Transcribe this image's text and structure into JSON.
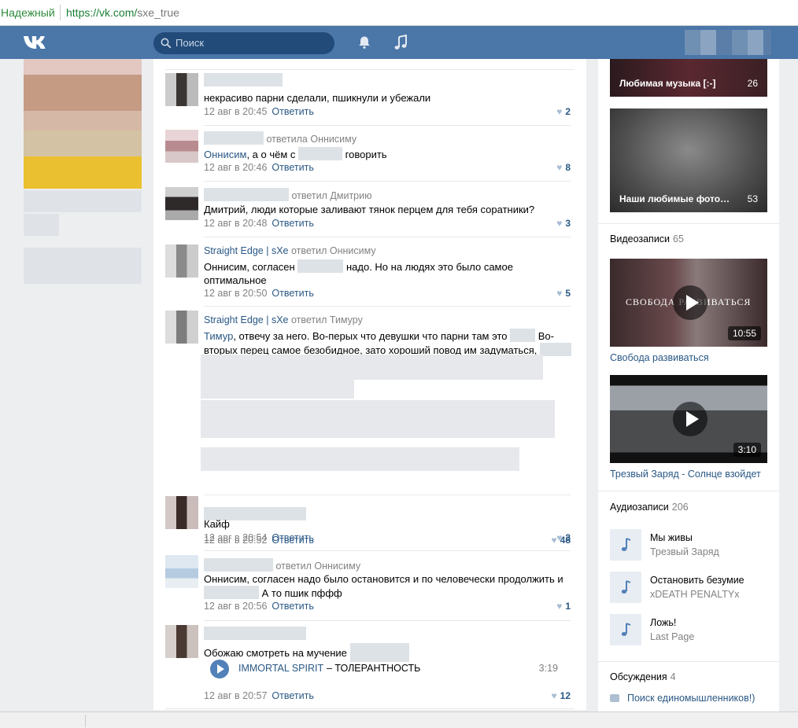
{
  "browser": {
    "secure_label": "Надежный",
    "url_host": "https://vk.com/",
    "url_path": "sxe_true"
  },
  "header": {
    "search_placeholder": "Поиск"
  },
  "comments": [
    {
      "author": "",
      "reply_to": "",
      "text": "некрасиво парни сделали, пшикнули и убежали",
      "time": "12 авг в 20:45",
      "answer": "Ответить",
      "likes": "2"
    },
    {
      "author": "",
      "reply_to": "ответила Оннисиму",
      "text_link": "Оннисим",
      "text_a": ", а о чём с",
      "text_b": "говорить",
      "time": "12 авг в 20:46",
      "answer": "Ответить",
      "likes": "8"
    },
    {
      "author": "",
      "reply_to": "ответил Дмитрию",
      "text": "Дмитрий, люди которые заливают тянок перцем для тебя соратники?",
      "time": "12 авг в 20:48",
      "answer": "Ответить",
      "likes": "3"
    },
    {
      "author": "Straight Edge | sXe",
      "reply_to": "ответил Оннисиму",
      "text_a": "Оннисим, согласен",
      "text_b": "надо. Но на людях это было самое оптимальное",
      "time": "12 авг в 20:50",
      "answer": "Ответить",
      "likes": "5"
    },
    {
      "author": "Straight Edge | sXe",
      "reply_to": "ответил Тимуру",
      "text_link": "Тимур",
      "text_a": ", отвечу за него. Во-перых что девушки что парни там это",
      "text_b": "Во-вторых перец самое безобидное, зато хороший повод им задуматься,",
      "time": "12 авг в 20:52",
      "answer": "Ответить",
      "likes": "48"
    },
    {
      "author": "",
      "reply_to": "",
      "text": "Кайф",
      "time": "12 авг в 20:54",
      "answer": "Ответить",
      "likes": "3"
    },
    {
      "author": "",
      "reply_to": "ответил Оннисиму",
      "text_a": "Оннисим, согласен надо было остановится и по человечески продолжить и",
      "text_b": "А то пшик пффф",
      "time": "12 авг в 20:56",
      "answer": "Ответить",
      "likes": "1"
    },
    {
      "author": "",
      "reply_to": "",
      "text": "Обожаю смотреть на мучение",
      "time": "12 авг в 20:57",
      "answer": "Ответить",
      "likes": "12"
    }
  ],
  "attached_audio": {
    "artist": "IMMORTAL SPIRIT",
    "title": "– ТОЛЕРАНТНОСТЬ",
    "duration": "3:19"
  },
  "sidebar": {
    "album1": {
      "label": "Любимая музыка [:-]",
      "count": "26"
    },
    "album2": {
      "label": "Наши любимые фото…",
      "count": "53"
    },
    "videos": {
      "title": "Видеозаписи",
      "count": "65"
    },
    "video1": {
      "title": "Свобода развиваться",
      "duration": "10:55",
      "overlay": "СВОБОДА РАЗВИВАТЬСЯ"
    },
    "video2": {
      "title": "Трезвый Заряд - Солнце взойдет",
      "duration": "3:10"
    },
    "audios": {
      "title": "Аудиозаписи",
      "count": "206"
    },
    "tracks": [
      {
        "name": "Мы живы",
        "artist": "Трезвый Заряд"
      },
      {
        "name": "Остановить безумие",
        "artist": "xDEATH PENALTYx"
      },
      {
        "name": "Ложь!",
        "artist": "Last Page"
      }
    ],
    "discussions": {
      "title": "Обсуждения",
      "count": "4",
      "item": "Поиск единомышленников!)"
    }
  },
  "colors": {
    "header": "#4a76a8",
    "link": "#2a5885",
    "muted": "#828282"
  }
}
